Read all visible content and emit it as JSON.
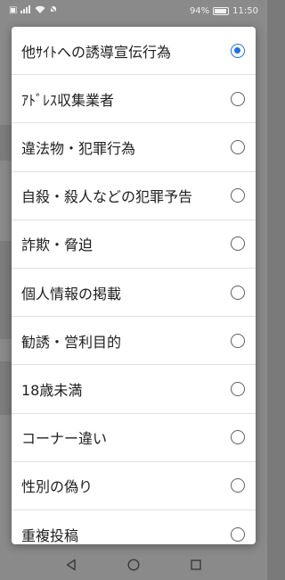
{
  "status_bar": {
    "battery_percent": "94%",
    "time": "11:50"
  },
  "dialog": {
    "options": [
      {
        "label": "他ｻｲﾄへの誘導宣伝行為",
        "selected": true
      },
      {
        "label": "ｱﾄﾞﾚｽ収集業者",
        "selected": false
      },
      {
        "label": "違法物・犯罪行為",
        "selected": false
      },
      {
        "label": "自殺・殺人などの犯罪予告",
        "selected": false
      },
      {
        "label": "詐欺・脅迫",
        "selected": false
      },
      {
        "label": "個人情報の掲載",
        "selected": false
      },
      {
        "label": "勧誘・営利目的",
        "selected": false
      },
      {
        "label": "18歳未満",
        "selected": false
      },
      {
        "label": "コーナー違い",
        "selected": false
      },
      {
        "label": "性別の偽り",
        "selected": false
      },
      {
        "label": "重複投稿",
        "selected": false
      }
    ]
  },
  "colors": {
    "accent": "#1a73e8",
    "scrim": "#8a8a8a"
  },
  "icons": [
    "sim-icon",
    "signal-icon",
    "wifi-icon",
    "mute-icon",
    "battery-icon",
    "back-icon",
    "home-icon",
    "recents-icon"
  ]
}
